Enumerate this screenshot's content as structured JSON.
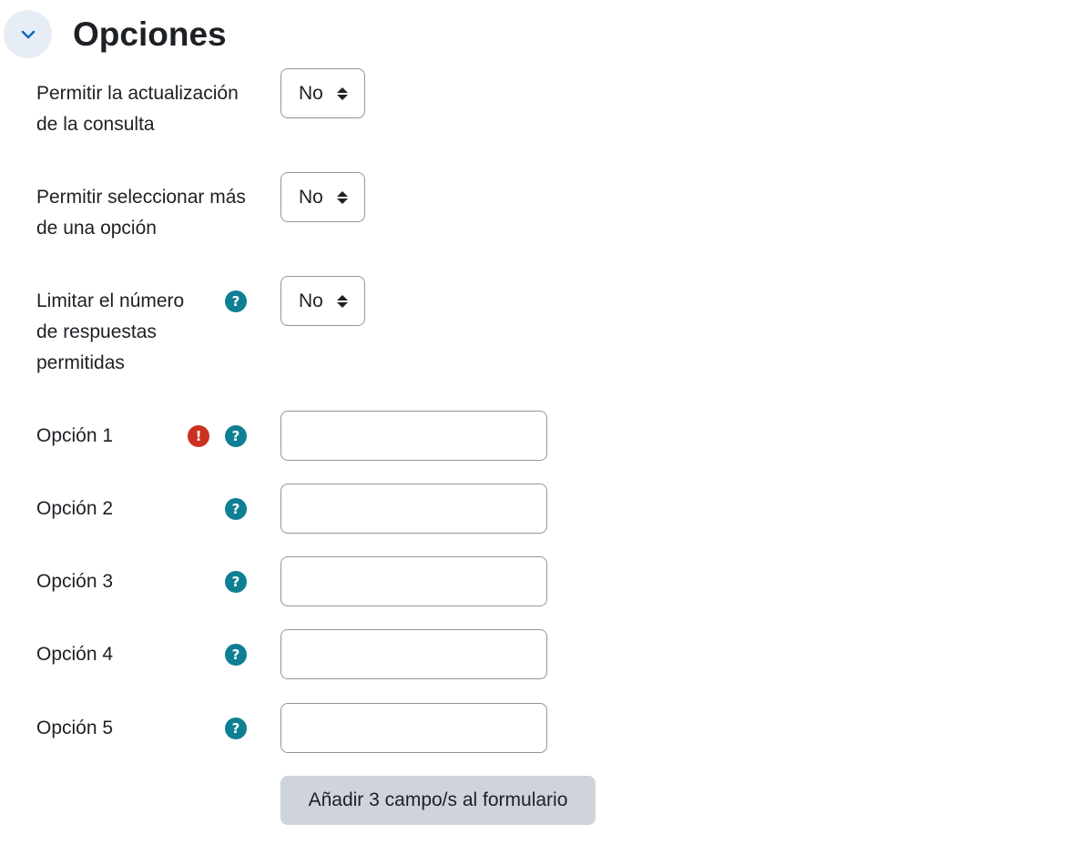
{
  "section": {
    "title": "Opciones"
  },
  "settings": [
    {
      "label": "Permitir la actualización de la consulta",
      "value": "No"
    },
    {
      "label": "Permitir seleccionar más de una opción",
      "value": "No"
    },
    {
      "label": "Limitar el número de respuestas permitidas",
      "value": "No"
    }
  ],
  "options": [
    {
      "label": "Opción 1",
      "value": "",
      "required": true
    },
    {
      "label": "Opción 2",
      "value": ""
    },
    {
      "label": "Opción 3",
      "value": ""
    },
    {
      "label": "Opción 4",
      "value": ""
    },
    {
      "label": "Opción 5",
      "value": ""
    }
  ],
  "icons": {
    "help": "?",
    "required": "!"
  },
  "add_button": {
    "label": "Añadir 3 campo/s al formulario"
  },
  "colors": {
    "help": "#0f7f93",
    "required": "#ca3120",
    "collapse_bg": "#e7edf4",
    "collapse_chevron": "#0f6cbf",
    "button_bg": "#ced4da"
  }
}
